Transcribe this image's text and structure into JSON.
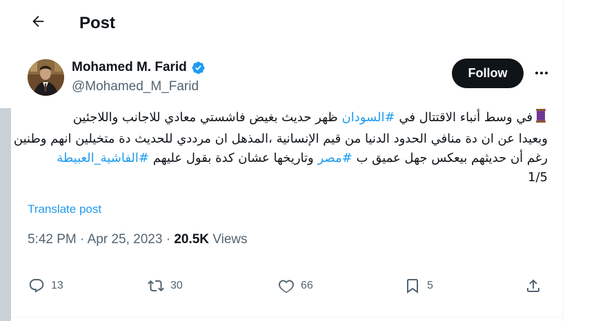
{
  "header": {
    "title": "Post"
  },
  "author": {
    "name": "Mohamed M. Farid",
    "handle": "@Mohamed_M_Farid",
    "verified": true
  },
  "follow_label": "Follow",
  "post": {
    "lines": [
      {
        "text_before": "في وسط أنباء الاقتتال في ",
        "hashtag": "#السودان",
        "text_after": " ظهر حديث بغيض فاشستي معادي للاجانب واللاجئين"
      },
      {
        "text_before": "وبعيدا عن ان دة منافي الحدود الدنيا من قيم الإنسانية ،المذهل ان مرددي للحديث دة متخيلين انهم وطنين",
        "hashtag": "",
        "text_after": ""
      },
      {
        "text_before": "رغم أن حديثهم بيعكس جهل عميق ب ",
        "hashtag": "#مصر",
        "text_after": " وتاريخها عشان كدة بقول عليهم ",
        "hashtag2": "#الفاشية_العبيطة"
      },
      {
        "text_before": "1/5",
        "hashtag": "",
        "text_after": ""
      }
    ]
  },
  "translate_label": "Translate post",
  "meta": {
    "time": "5:42 PM",
    "separator": " · ",
    "date": "Apr 25, 2023",
    "views_count": "20.5K",
    "views_label": " Views"
  },
  "actions": {
    "replies": "13",
    "reposts": "30",
    "likes": "66",
    "bookmarks": "5"
  },
  "icons": [
    "back-arrow-icon",
    "verified-badge-icon",
    "more-options-icon",
    "thread-emoji-icon",
    "reply-icon",
    "repost-icon",
    "like-icon",
    "bookmark-icon",
    "share-icon"
  ],
  "colors": {
    "accent": "#1d9bf0",
    "text": "#0f1419",
    "secondary": "#536471",
    "follow_bg": "#0f1419"
  }
}
